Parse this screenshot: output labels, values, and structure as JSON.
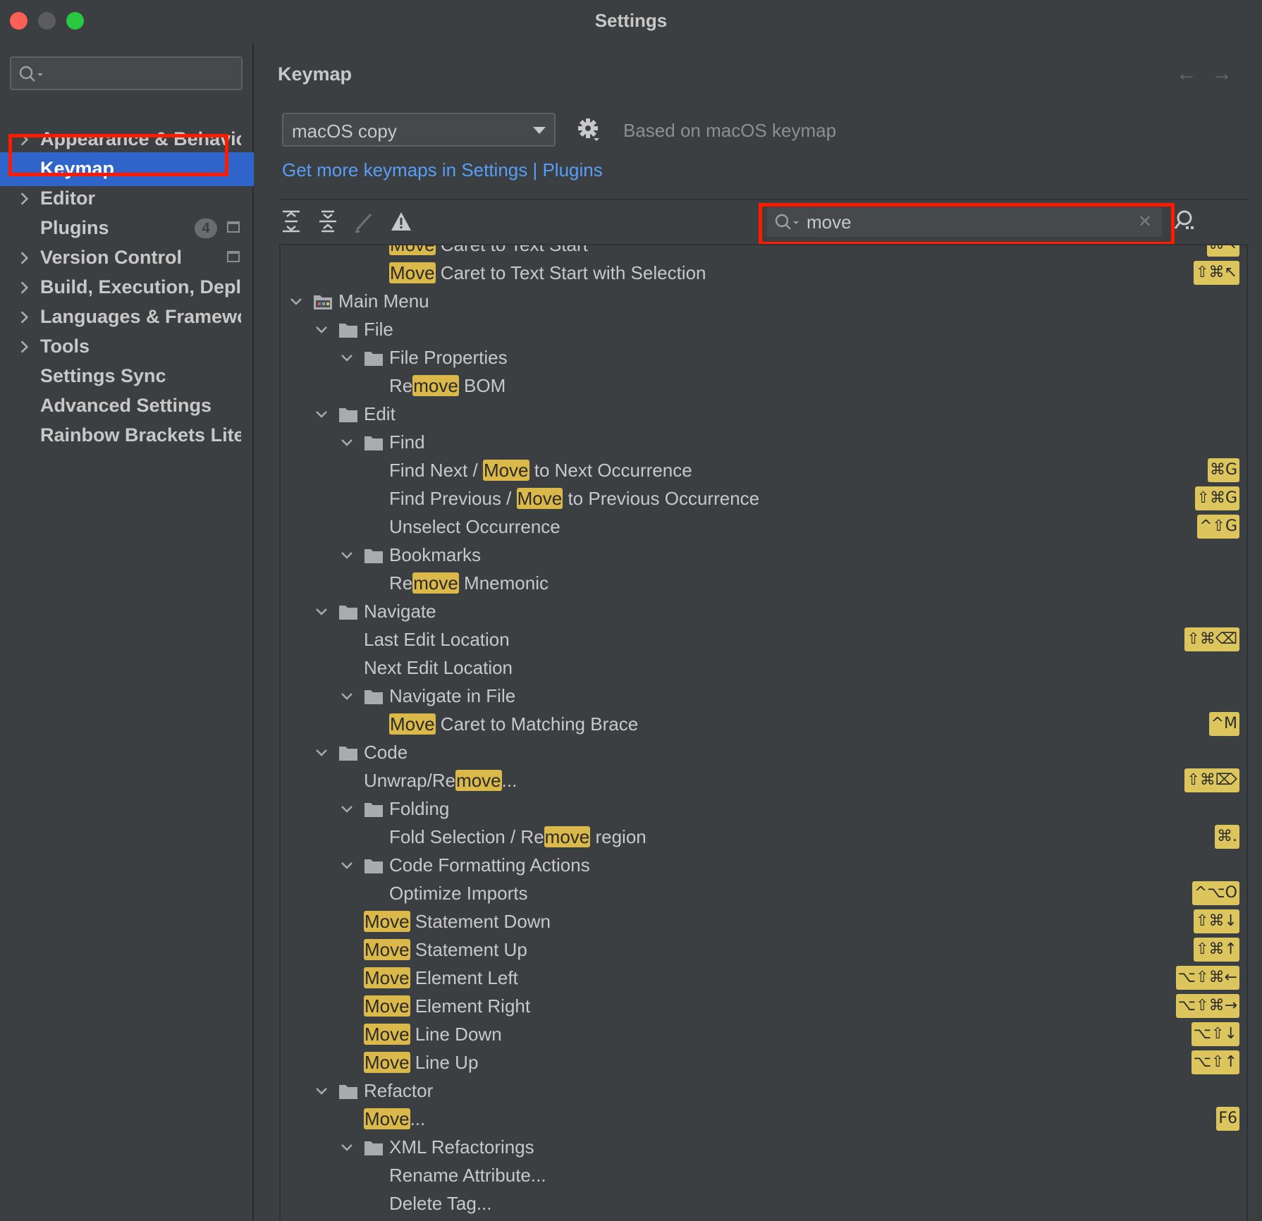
{
  "window": {
    "title": "Settings"
  },
  "sidebar": {
    "search_placeholder": "",
    "items": [
      {
        "label": "Appearance & Behavior",
        "expandable": true
      },
      {
        "label": "Keymap",
        "expandable": false,
        "selected": true
      },
      {
        "label": "Editor",
        "expandable": true
      },
      {
        "label": "Plugins",
        "expandable": false,
        "badge": "4"
      },
      {
        "label": "Version Control",
        "expandable": true
      },
      {
        "label": "Build, Execution, Deployment",
        "expandable": true
      },
      {
        "label": "Languages & Frameworks",
        "expandable": true
      },
      {
        "label": "Tools",
        "expandable": true
      },
      {
        "label": "Settings Sync",
        "expandable": false
      },
      {
        "label": "Advanced Settings",
        "expandable": false
      },
      {
        "label": "Rainbow Brackets Lite",
        "expandable": false
      }
    ]
  },
  "main": {
    "title": "Keymap",
    "back_arrow": "←",
    "forward_arrow": "→",
    "keymap_select": "macOS copy",
    "based_on": "Based on macOS keymap",
    "get_more_link": "Get more keymaps in Settings | Plugins",
    "filter_value": "move",
    "clear_glyph": "✕"
  },
  "tree": [
    {
      "level": 3,
      "type": "action",
      "parts": [
        [
          "Move",
          true
        ],
        [
          " Caret to Text Start",
          false
        ]
      ],
      "shortcut": "⌘↖",
      "partial": true
    },
    {
      "level": 3,
      "type": "action",
      "parts": [
        [
          "Move",
          true
        ],
        [
          " Caret to Text Start with Selection",
          false
        ]
      ],
      "shortcut": "⇧⌘↖"
    },
    {
      "level": 0,
      "type": "group",
      "main": true,
      "parts": [
        [
          "Main Menu",
          false
        ]
      ]
    },
    {
      "level": 1,
      "type": "group",
      "parts": [
        [
          "File",
          false
        ]
      ]
    },
    {
      "level": 2,
      "type": "group",
      "parts": [
        [
          "File Properties",
          false
        ]
      ]
    },
    {
      "level": 3,
      "type": "action",
      "parts": [
        [
          "Re",
          false
        ],
        [
          "move",
          true
        ],
        [
          " BOM",
          false
        ]
      ]
    },
    {
      "level": 1,
      "type": "group",
      "parts": [
        [
          "Edit",
          false
        ]
      ]
    },
    {
      "level": 2,
      "type": "group",
      "parts": [
        [
          "Find",
          false
        ]
      ]
    },
    {
      "level": 3,
      "type": "action",
      "parts": [
        [
          "Find Next / ",
          false
        ],
        [
          "Move",
          true
        ],
        [
          " to Next Occurrence",
          false
        ]
      ],
      "shortcut": "⌘G"
    },
    {
      "level": 3,
      "type": "action",
      "parts": [
        [
          "Find Previous / ",
          false
        ],
        [
          "Move",
          true
        ],
        [
          " to Previous Occurrence",
          false
        ]
      ],
      "shortcut": "⇧⌘G"
    },
    {
      "level": 3,
      "type": "action",
      "parts": [
        [
          "Unselect Occurrence",
          false
        ]
      ],
      "shortcut": "^⇧G"
    },
    {
      "level": 2,
      "type": "group",
      "parts": [
        [
          "Bookmarks",
          false
        ]
      ]
    },
    {
      "level": 3,
      "type": "action",
      "parts": [
        [
          "Re",
          false
        ],
        [
          "move",
          true
        ],
        [
          " Mnemonic",
          false
        ]
      ]
    },
    {
      "level": 1,
      "type": "group",
      "parts": [
        [
          "Navigate",
          false
        ]
      ]
    },
    {
      "level": 2,
      "type": "action",
      "parts": [
        [
          "Last Edit Location",
          false
        ]
      ],
      "shortcut": "⇧⌘⌫"
    },
    {
      "level": 2,
      "type": "action",
      "parts": [
        [
          "Next Edit Location",
          false
        ]
      ]
    },
    {
      "level": 2,
      "type": "group",
      "parts": [
        [
          "Navigate in File",
          false
        ]
      ]
    },
    {
      "level": 3,
      "type": "action",
      "parts": [
        [
          "Move",
          true
        ],
        [
          " Caret to Matching Brace",
          false
        ]
      ],
      "shortcut": "^M"
    },
    {
      "level": 1,
      "type": "group",
      "parts": [
        [
          "Code",
          false
        ]
      ]
    },
    {
      "level": 2,
      "type": "action",
      "parts": [
        [
          "Unwrap/Re",
          false
        ],
        [
          "move",
          true
        ],
        [
          "...",
          false
        ]
      ],
      "shortcut": "⇧⌘⌦"
    },
    {
      "level": 2,
      "type": "group",
      "parts": [
        [
          "Folding",
          false
        ]
      ]
    },
    {
      "level": 3,
      "type": "action",
      "parts": [
        [
          "Fold Selection / Re",
          false
        ],
        [
          "move",
          true
        ],
        [
          " region",
          false
        ]
      ],
      "shortcut": "⌘."
    },
    {
      "level": 2,
      "type": "group",
      "parts": [
        [
          "Code Formatting Actions",
          false
        ]
      ]
    },
    {
      "level": 3,
      "type": "action",
      "parts": [
        [
          "Optimize Imports",
          false
        ]
      ],
      "shortcut": "^⌥O"
    },
    {
      "level": 2,
      "type": "action",
      "parts": [
        [
          "Move",
          true
        ],
        [
          " Statement Down",
          false
        ]
      ],
      "shortcut": "⇧⌘↓"
    },
    {
      "level": 2,
      "type": "action",
      "parts": [
        [
          "Move",
          true
        ],
        [
          " Statement Up",
          false
        ]
      ],
      "shortcut": "⇧⌘↑"
    },
    {
      "level": 2,
      "type": "action",
      "parts": [
        [
          "Move",
          true
        ],
        [
          " Element Left",
          false
        ]
      ],
      "shortcut": "⌥⇧⌘←"
    },
    {
      "level": 2,
      "type": "action",
      "parts": [
        [
          "Move",
          true
        ],
        [
          " Element Right",
          false
        ]
      ],
      "shortcut": "⌥⇧⌘→"
    },
    {
      "level": 2,
      "type": "action",
      "parts": [
        [
          "Move",
          true
        ],
        [
          " Line Down",
          false
        ]
      ],
      "shortcut": "⌥⇧↓"
    },
    {
      "level": 2,
      "type": "action",
      "parts": [
        [
          "Move",
          true
        ],
        [
          " Line Up",
          false
        ]
      ],
      "shortcut": "⌥⇧↑"
    },
    {
      "level": 1,
      "type": "group",
      "parts": [
        [
          "Refactor",
          false
        ]
      ]
    },
    {
      "level": 2,
      "type": "action",
      "parts": [
        [
          "Move",
          true
        ],
        [
          "...",
          false
        ]
      ],
      "shortcut": "F6"
    },
    {
      "level": 2,
      "type": "group",
      "parts": [
        [
          "XML Refactorings",
          false
        ]
      ]
    },
    {
      "level": 3,
      "type": "action",
      "parts": [
        [
          "Rename Attribute...",
          false
        ]
      ]
    },
    {
      "level": 3,
      "type": "action",
      "parts": [
        [
          "Delete Tag...",
          false
        ]
      ]
    }
  ]
}
